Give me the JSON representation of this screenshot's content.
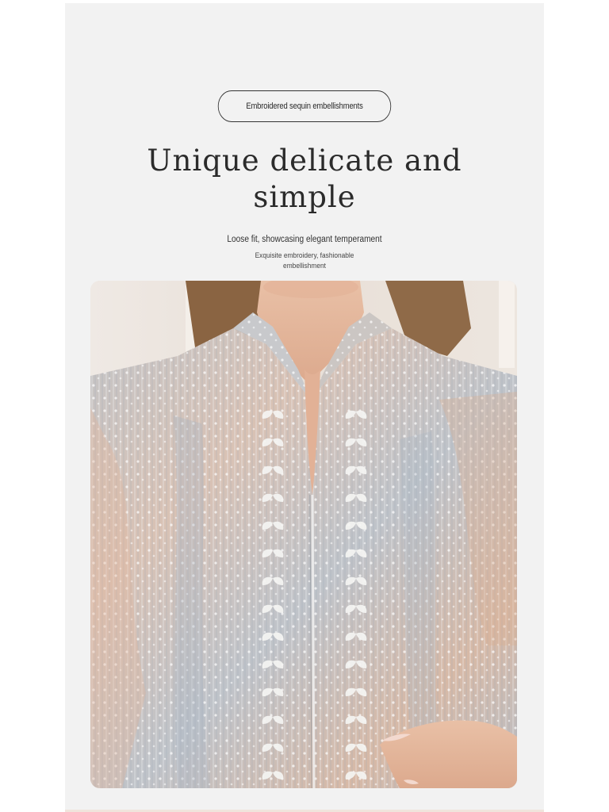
{
  "badge": {
    "label": "Embroidered sequin embellishments"
  },
  "headline": {
    "line1": "Unique delicate and",
    "line2": "simple"
  },
  "subtitle": "Loose fit, showcasing elegant temperament",
  "caption": {
    "line1": "Exquisite embroidery, fashionable",
    "line2": "embellishment"
  },
  "colors": {
    "page_background": "#f2f2f2",
    "text_primary": "#2b2b2b",
    "fabric_base": "#c9c7c6",
    "fabric_peach": "#e0b59a",
    "fabric_blue": "#a9b4bf",
    "skin": "#e6b89f",
    "hair": "#8a6442"
  },
  "photo": {
    "subject": "model-wearing-embroidered-sequin-blouse"
  }
}
